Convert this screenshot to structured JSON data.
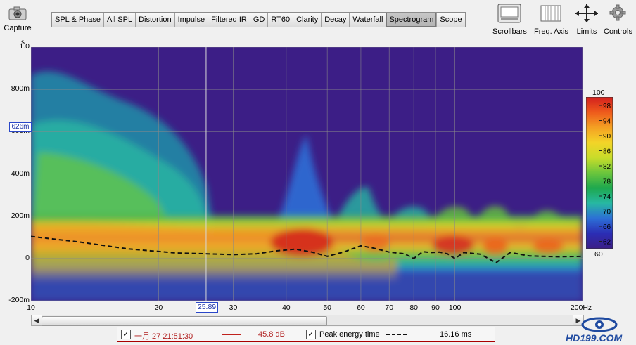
{
  "toolbar": {
    "capture_label": "Capture",
    "tabs": [
      "SPL & Phase",
      "All SPL",
      "Distortion",
      "Impulse",
      "Filtered IR",
      "GD",
      "RT60",
      "Clarity",
      "Decay",
      "Waterfall",
      "Spectrogram",
      "Scope"
    ],
    "active_tab": "Spectrogram",
    "tools": [
      {
        "label": "Scrollbars",
        "icon": "scrollbars-icon"
      },
      {
        "label": "Freq. Axis",
        "icon": "freq-axis-icon"
      },
      {
        "label": "Limits",
        "icon": "limits-icon"
      },
      {
        "label": "Controls",
        "icon": "gear-icon"
      }
    ]
  },
  "chart_data": {
    "type": "heatmap",
    "title": "",
    "y_unit": "s",
    "y_ticks": [
      "1.0",
      "800m",
      "600m",
      "400m",
      "200m",
      "0",
      "-200m"
    ],
    "y_range_s": [
      -0.2,
      1.0
    ],
    "x_ticks": [
      "10",
      "20",
      "30",
      "40",
      "50",
      "60",
      "70",
      "80",
      "90",
      "100",
      "200Hz"
    ],
    "x_range_hz": [
      10,
      200
    ],
    "x_scale": "log",
    "cursor_x": "25.89",
    "cursor_y": "626m",
    "colorbar": {
      "top": "100",
      "bottom": "60",
      "ticks": [
        "98",
        "94",
        "90",
        "86",
        "82",
        "78",
        "74",
        "70",
        "66",
        "62"
      ],
      "colors": [
        "#d21e1e",
        "#ee5a1c",
        "#f4a023",
        "#f3d428",
        "#c8dc2a",
        "#6cc63c",
        "#1ea84e",
        "#27b8a2",
        "#2c6fd6",
        "#2b2db4",
        "#3c1e86"
      ]
    },
    "background_color": "#3c1e86",
    "peak_energy_time_ms": [
      [
        10,
        0.104
      ],
      [
        13,
        0.078
      ],
      [
        17,
        0.045
      ],
      [
        22,
        0.026
      ],
      [
        26,
        0.022
      ],
      [
        30,
        0.018
      ],
      [
        34,
        0.022
      ],
      [
        38,
        0.036
      ],
      [
        42,
        0.044
      ],
      [
        46,
        0.03
      ],
      [
        50,
        0.01
      ],
      [
        55,
        0.032
      ],
      [
        60,
        0.06
      ],
      [
        64,
        0.05
      ],
      [
        70,
        0.03
      ],
      [
        76,
        0.022
      ],
      [
        80,
        0.0
      ],
      [
        84,
        0.032
      ],
      [
        88,
        0.028
      ],
      [
        92,
        0.03
      ],
      [
        96,
        0.022
      ],
      [
        100,
        0.0
      ],
      [
        105,
        0.028
      ],
      [
        115,
        0.02
      ],
      [
        125,
        -0.02
      ],
      [
        135,
        0.028
      ],
      [
        150,
        0.012
      ],
      [
        175,
        0.008
      ],
      [
        200,
        0.01
      ]
    ],
    "grid": true
  },
  "legend": {
    "row1_checked": true,
    "row1_label": "一月 27 21:51:30",
    "row1_value": "45.8 dB",
    "row1_color": "#c0221d",
    "row2_checked": true,
    "row2_label": "Peak energy time",
    "row2_value": "16.16 ms"
  },
  "watermark": {
    "text": "HD199.COM"
  }
}
